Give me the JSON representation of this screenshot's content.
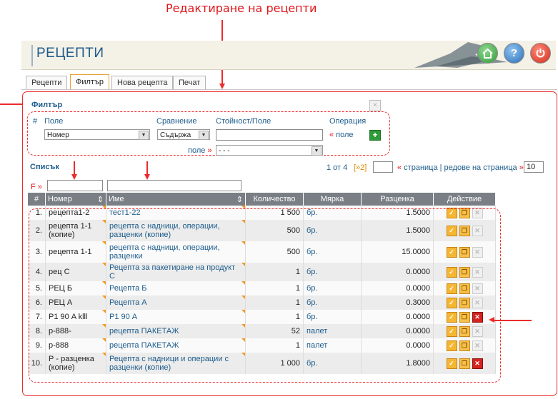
{
  "annotation": {
    "title": "Редактиране на рецепти"
  },
  "header": {
    "title": "РЕЦЕПТИ",
    "home_icon": "home-icon",
    "help_label": "?",
    "power_icon": "power-icon"
  },
  "tabs": [
    {
      "label": "Рецепти"
    },
    {
      "label": "Филтър",
      "active": true
    },
    {
      "label": "Нова рецепта"
    },
    {
      "label": "Печат"
    }
  ],
  "filter": {
    "title": "Филтър",
    "close": "×",
    "col_hash": "#",
    "col_field": "Поле",
    "col_compare": "Сравнение",
    "col_value": "Стойност/Поле",
    "col_operation": "Операция",
    "field_value": "Номер",
    "compare_value": "Съдържа",
    "value_input": "",
    "add_field_link": "« поле",
    "field_link": "поле »",
    "field_select_value": "- - -",
    "plus": "+"
  },
  "list": {
    "title": "Списък",
    "page_info": "1 от 4",
    "next_link": "[»2]",
    "page_input": "",
    "page_links": "« страница | редове на страница »",
    "rows_per_page": "10",
    "f_label": "F »"
  },
  "table": {
    "headers": [
      "#",
      "Номер",
      "Име",
      "Количество",
      "Мярка",
      "Разценка",
      "Действие"
    ],
    "rows": [
      {
        "n": "1.",
        "code": "рецепта1-2",
        "name": "тест1-22",
        "qty": "1 500",
        "unit": "бр.",
        "price": "1.5000",
        "del": false
      },
      {
        "n": "2.",
        "code": "рецепта 1-1 (копие)",
        "name": "рецепта с надници, операции, разценки (копие)",
        "qty": "500",
        "unit": "бр.",
        "price": "1.5000",
        "del": false
      },
      {
        "n": "3.",
        "code": "рецепта 1-1",
        "name": "рецепта с надници, операции, разценки",
        "qty": "500",
        "unit": "бр.",
        "price": "15.0000",
        "del": false
      },
      {
        "n": "4.",
        "code": "рец С",
        "name": "Рецепта за пакетиране на продукт С",
        "qty": "1",
        "unit": "бр.",
        "price": "0.0000",
        "del": false
      },
      {
        "n": "5.",
        "code": "РЕЦ Б",
        "name": "Рецепта Б",
        "qty": "1",
        "unit": "бр.",
        "price": "0.0000",
        "del": false
      },
      {
        "n": "6.",
        "code": "РЕЦ А",
        "name": "Рецепта А",
        "qty": "1",
        "unit": "бр.",
        "price": "0.3000",
        "del": false
      },
      {
        "n": "7.",
        "code": "Р1 90 A klll",
        "name": "Р1 90 A",
        "qty": "1",
        "unit": "бр.",
        "price": "0.0000",
        "del": true
      },
      {
        "n": "8.",
        "code": "р-888-",
        "name": "рецепта ПАКЕТАЖ",
        "qty": "52",
        "unit": "палет",
        "price": "0.0000",
        "del": false
      },
      {
        "n": "9.",
        "code": "р-888",
        "name": "рецепта ПАКЕТАЖ",
        "qty": "1",
        "unit": "палет",
        "price": "0.0000",
        "del": false
      },
      {
        "n": "10.",
        "code": "Р - разценка (копие)",
        "name": "Рецепта с надници и операции с разценки (копие)",
        "qty": "1 000",
        "unit": "бр.",
        "price": "1.8000",
        "del": true
      }
    ]
  },
  "colors": {
    "accent": "#1d5c8c",
    "annotation": "#ec2b2b",
    "header_bg": "#7a7f86"
  }
}
